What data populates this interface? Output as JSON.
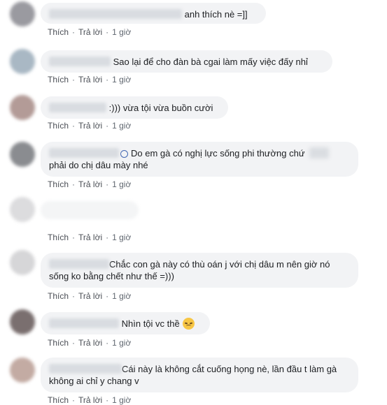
{
  "comments": [
    {
      "text": "anh thích nè =]]",
      "actions": {
        "like": "Thích",
        "reply": "Trả lời",
        "time": "1 giờ"
      }
    },
    {
      "text": "Sao lại để cho đàn bà cgai làm mấy việc đấy nhỉ",
      "actions": {
        "like": "Thích",
        "reply": "Trả lời",
        "time": "1 giờ"
      }
    },
    {
      "text": ":))) vừa tội vừa buồn cười",
      "actions": {
        "like": "Thích",
        "reply": "Trả lời",
        "time": "1 giờ"
      }
    },
    {
      "line1": "Do em gà có nghị lực sống phi thường chứ",
      "line2": "phải do chị dâu mày nhé",
      "actions": {
        "like": "Thích",
        "reply": "Trả lời",
        "time": "1 giờ"
      }
    },
    {
      "text": "",
      "actions": {
        "like": "Thích",
        "reply": "Trả lời",
        "time": "1 giờ"
      }
    },
    {
      "line1": "Chắc con gà này có thù oán j với chị dâu m nên giờ nó",
      "line2": "sống ko bằng chết như thế =)))",
      "actions": {
        "like": "Thích",
        "reply": "Trả lời",
        "time": "1 giờ"
      }
    },
    {
      "text": "Nhìn tội vc thề",
      "emoji": "disappointed-face",
      "actions": {
        "like": "Thích",
        "reply": "Trả lời",
        "time": "1 giờ"
      }
    },
    {
      "line1": "Cái này là không cắt cuống họng nè, lần đầu t làm gà",
      "line2": "không ai chỉ y chang v",
      "actions": {
        "like": "Thích",
        "reply": "Trả lời",
        "time": "1 giờ"
      }
    }
  ],
  "colors": {
    "bubble": "#f2f3f5",
    "text": "#1c1e21",
    "meta": "#606770",
    "link_accent": "#4267b2"
  }
}
